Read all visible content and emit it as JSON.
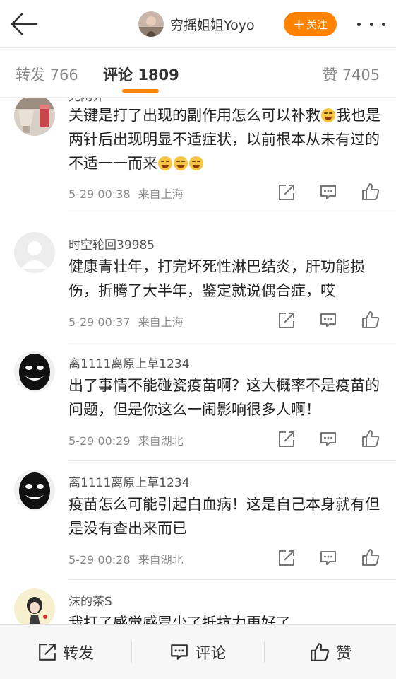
{
  "header": {
    "username": "穷摇姐姐Yoyo",
    "follow_label": "关注",
    "follow_plus": "+",
    "accent_color": "#ff8200"
  },
  "tabs": [
    {
      "label": "转发",
      "count": "766",
      "active": false
    },
    {
      "label": "评论",
      "count": "1809",
      "active": true
    },
    {
      "label": "赞",
      "count": "7405",
      "active": false
    }
  ],
  "comments": [
    {
      "name": "兆闲乔",
      "text_before_emoji": "关键是打了出现的副作用怎么可以补救",
      "text_middle": "我也是两针后出现明显不适症状，以前根本从未有过的不适一一而来",
      "text": "",
      "time": "5-29 00:38",
      "location": "来自上海",
      "avatar": "drink-photo"
    },
    {
      "name": "时空轮回39985",
      "text": "健康青壮年，打完坏死性淋巴结炎，肝功能损伤，折腾了大半年，鉴定就说偶合症，哎",
      "time": "5-29 00:37",
      "location": "来自上海",
      "avatar": "default-avatar"
    },
    {
      "name": "离1111离原上草1234",
      "text": "出了事情不能碰瓷疫苗啊？这大概率不是疫苗的问题，但是你这么一闹影响很多人啊！",
      "time": "5-29 00:29",
      "location": "来自湖北",
      "avatar": "smile-face-avatar"
    },
    {
      "name": "离1111离原上草1234",
      "text": "疫苗怎么可能引起白血病！这是自己本身就有但是没有查出来而已",
      "time": "5-29 00:28",
      "location": "来自湖北",
      "avatar": "smile-face-avatar"
    },
    {
      "name": "沫的茶S",
      "text": "我打了感觉感冒少了抵抗力更好了",
      "time": "",
      "location": "",
      "avatar": "cartoon-girl-avatar"
    }
  ],
  "bottombar": {
    "repost": "转发",
    "comment": "评论",
    "like": "赞"
  }
}
